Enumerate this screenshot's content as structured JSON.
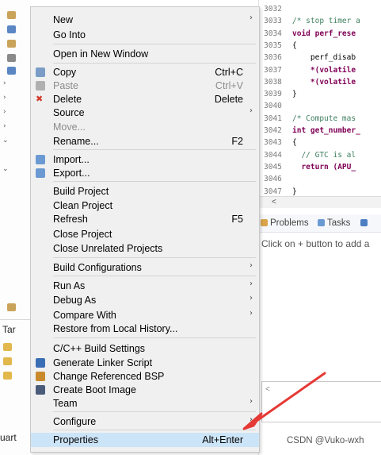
{
  "menu": {
    "items": [
      {
        "label": "New",
        "shortcut": "",
        "submenu": true,
        "disabled": false
      },
      {
        "label": "Go Into",
        "shortcut": "",
        "submenu": false,
        "disabled": false
      },
      {
        "label": "Open in New Window",
        "shortcut": "",
        "submenu": false,
        "disabled": false
      },
      {
        "label": "Copy",
        "shortcut": "Ctrl+C",
        "submenu": false,
        "disabled": false,
        "icon": "copy-icon"
      },
      {
        "label": "Paste",
        "shortcut": "Ctrl+V",
        "submenu": false,
        "disabled": true,
        "icon": "paste-icon"
      },
      {
        "label": "Delete",
        "shortcut": "Delete",
        "submenu": false,
        "disabled": false,
        "icon": "delete-icon"
      },
      {
        "label": "Source",
        "shortcut": "",
        "submenu": true,
        "disabled": false
      },
      {
        "label": "Move...",
        "shortcut": "",
        "submenu": false,
        "disabled": true
      },
      {
        "label": "Rename...",
        "shortcut": "F2",
        "submenu": false,
        "disabled": false
      },
      {
        "label": "Import...",
        "shortcut": "",
        "submenu": false,
        "disabled": false,
        "icon": "import-icon"
      },
      {
        "label": "Export...",
        "shortcut": "",
        "submenu": false,
        "disabled": false,
        "icon": "export-icon"
      },
      {
        "label": "Build Project",
        "shortcut": "",
        "submenu": false,
        "disabled": false
      },
      {
        "label": "Clean Project",
        "shortcut": "",
        "submenu": false,
        "disabled": false
      },
      {
        "label": "Refresh",
        "shortcut": "F5",
        "submenu": false,
        "disabled": false
      },
      {
        "label": "Close Project",
        "shortcut": "",
        "submenu": false,
        "disabled": false
      },
      {
        "label": "Close Unrelated Projects",
        "shortcut": "",
        "submenu": false,
        "disabled": false
      },
      {
        "label": "Build Configurations",
        "shortcut": "",
        "submenu": true,
        "disabled": false
      },
      {
        "label": "Run As",
        "shortcut": "",
        "submenu": true,
        "disabled": false
      },
      {
        "label": "Debug As",
        "shortcut": "",
        "submenu": true,
        "disabled": false
      },
      {
        "label": "Compare With",
        "shortcut": "",
        "submenu": true,
        "disabled": false
      },
      {
        "label": "Restore from Local History...",
        "shortcut": "",
        "submenu": false,
        "disabled": false
      },
      {
        "label": "C/C++ Build Settings",
        "shortcut": "",
        "submenu": false,
        "disabled": false
      },
      {
        "label": "Generate Linker Script",
        "shortcut": "",
        "submenu": false,
        "disabled": false,
        "icon": "linker-script-icon"
      },
      {
        "label": "Change Referenced BSP",
        "shortcut": "",
        "submenu": false,
        "disabled": false,
        "icon": "bsp-icon"
      },
      {
        "label": "Create Boot Image",
        "shortcut": "",
        "submenu": false,
        "disabled": false,
        "icon": "boot-image-icon"
      },
      {
        "label": "Team",
        "shortcut": "",
        "submenu": true,
        "disabled": false
      },
      {
        "label": "Configure",
        "shortcut": "",
        "submenu": true,
        "disabled": false
      },
      {
        "label": "Properties",
        "shortcut": "Alt+Enter",
        "submenu": false,
        "disabled": false,
        "highlighted": true
      }
    ]
  },
  "editor": {
    "lines": [
      {
        "num": "3032",
        "code": ""
      },
      {
        "num": "3033",
        "code": "/* stop timer a"
      },
      {
        "num": "3034",
        "code": "void perf_rese"
      },
      {
        "num": "3035",
        "code": "{"
      },
      {
        "num": "3036",
        "code": "    perf_disab"
      },
      {
        "num": "3037",
        "code": "    *(volatile"
      },
      {
        "num": "3038",
        "code": "    *(volatile"
      },
      {
        "num": "3039",
        "code": "}"
      },
      {
        "num": "3040",
        "code": ""
      },
      {
        "num": "3041",
        "code": "/* Compute mas"
      },
      {
        "num": "3042",
        "code": "int get_number_"
      },
      {
        "num": "3043",
        "code": "{"
      },
      {
        "num": "3044",
        "code": "  // GTC is al"
      },
      {
        "num": "3045",
        "code": "  return (APU_"
      },
      {
        "num": "3046",
        "code": ""
      },
      {
        "num": "3047",
        "code": "}"
      }
    ]
  },
  "panel": {
    "tabs": [
      "Problems",
      "Tasks"
    ],
    "hint": "Click on + button to add a"
  },
  "left_strip": {
    "labels": [
      "Tar",
      "uart"
    ]
  },
  "watermark": "CSDN @Vuko-wxh",
  "colors": {
    "highlight": "#cce4f7",
    "menu_bg": "#f0f0f0",
    "annotation_arrow": "#e53935",
    "comment": "#3f7f5f",
    "keyword": "#7f0055"
  }
}
